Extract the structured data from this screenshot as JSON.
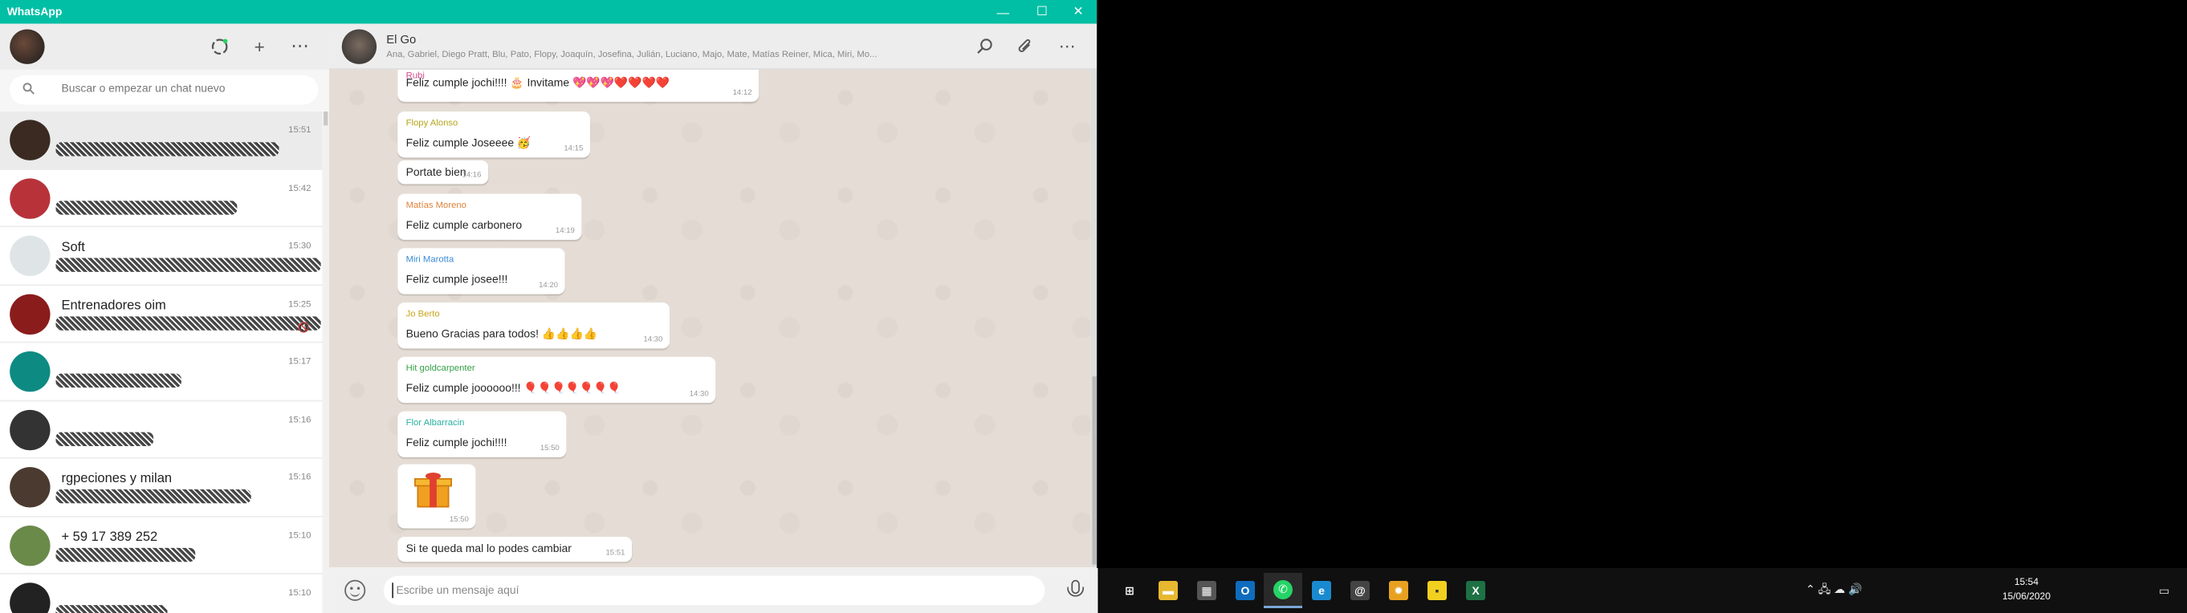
{
  "window": {
    "title": "WhatsApp",
    "minimize": "—",
    "maximize": "☐",
    "close": "✕"
  },
  "sidebar": {
    "search_placeholder": "Buscar o empezar un chat nuevo",
    "icons": {
      "status": "status-icon",
      "new_chat": "+",
      "menu": "⋯"
    },
    "chats": [
      {
        "name": "",
        "time": "15:51",
        "active": true,
        "avatar": "#3a2a22"
      },
      {
        "name": "",
        "time": "15:42",
        "active": false,
        "avatar": "#b8323a"
      },
      {
        "name": "Soft",
        "time": "15:30",
        "active": false,
        "avatar": "#dfe5e7"
      },
      {
        "name": "Entrenadores oim",
        "time": "15:25",
        "active": false,
        "avatar": "#8a1c1c",
        "muted": true
      },
      {
        "name": "",
        "time": "15:17",
        "active": false,
        "avatar": "#0d8a82"
      },
      {
        "name": "",
        "time": "15:16",
        "active": false,
        "avatar": "#333333"
      },
      {
        "name": "rgpeciones y milan",
        "time": "15:16",
        "active": false,
        "avatar": "#4a3a30"
      },
      {
        "name": "+ 59 17 389 252",
        "time": "15:10",
        "active": false,
        "avatar": "#6a8a4a"
      },
      {
        "name": "",
        "time": "15:10",
        "active": false,
        "avatar": "#222222"
      }
    ]
  },
  "conversation": {
    "group_name": "El Go",
    "members": "Ana, Gabriel, Diego Pratt, Blu, Pato, Flopy, Joaquín, Josefina, Julián, Luciano, Majo, Mate, Matías Reiner, Mica, Miri, Mo...",
    "compose_placeholder": "Escribe un mensaje aquí",
    "messages": [
      {
        "sender": "Rubi",
        "sender_color": "#d64a8a",
        "text": "Feliz cumple jochi!!!! 🎂 Invitame 💖💖💖❤️❤️❤️❤️",
        "time": "14:12"
      },
      {
        "sender": "Flopy Alonso",
        "sender_color": "#b5a51a",
        "text": "Feliz cumple Joseeee 🥳",
        "time": "14:15"
      },
      {
        "sender": "",
        "sender_color": "",
        "text": "Portate bien",
        "time": "14:16"
      },
      {
        "sender": "Matías Moreno",
        "sender_color": "#e0823a",
        "text": "Feliz cumple carbonero",
        "time": "14:19"
      },
      {
        "sender": "Miri Marotta",
        "sender_color": "#3a8ad6",
        "text": "Feliz cumple josee!!!",
        "time": "14:20"
      },
      {
        "sender": "Jo Berto",
        "sender_color": "#c9a41a",
        "text": "Bueno Gracias para todos! 👍👍👍👍",
        "time": "14:30"
      },
      {
        "sender": "Hit goldcarpenter",
        "sender_color": "#34a045",
        "text": "Feliz cumple joooooo!!! 🎈🎈🎈🎈🎈🎈🎈",
        "time": "14:30"
      },
      {
        "sender": "Flor Albarracin",
        "sender_color": "#2ab0a0",
        "text": "Feliz cumple jochi!!!!",
        "time": "15:50"
      },
      {
        "sender": "",
        "sender_color": "",
        "text": "",
        "time": "15:50",
        "sticker": "gift"
      },
      {
        "sender": "",
        "sender_color": "",
        "text": "Si te queda mal lo podes cambiar",
        "time": "15:51"
      }
    ]
  },
  "taskbar": {
    "apps": [
      {
        "name": "start",
        "glyph": "⊞",
        "color": "#ffffff"
      },
      {
        "name": "file-explorer",
        "glyph": "▬",
        "color": "#e8b830"
      },
      {
        "name": "calculator",
        "glyph": "▦",
        "color": "#555555"
      },
      {
        "name": "outlook",
        "glyph": "O",
        "color": "#0f6cbd"
      },
      {
        "name": "whatsapp",
        "glyph": "✆",
        "color": "#25d366"
      },
      {
        "name": "edge",
        "glyph": "e",
        "color": "#1a8ad0"
      },
      {
        "name": "mail-app",
        "glyph": "@",
        "color": "#444444"
      },
      {
        "name": "sun-app",
        "glyph": "✹",
        "color": "#e8a020"
      },
      {
        "name": "sticky-notes",
        "glyph": "▪",
        "color": "#f2d020"
      },
      {
        "name": "excel",
        "glyph": "X",
        "color": "#1e7145"
      }
    ],
    "tray_icons": "⌃  🖧  ☁  🔊",
    "time": "15:54",
    "date": "15/06/2020",
    "notification": "▭"
  }
}
